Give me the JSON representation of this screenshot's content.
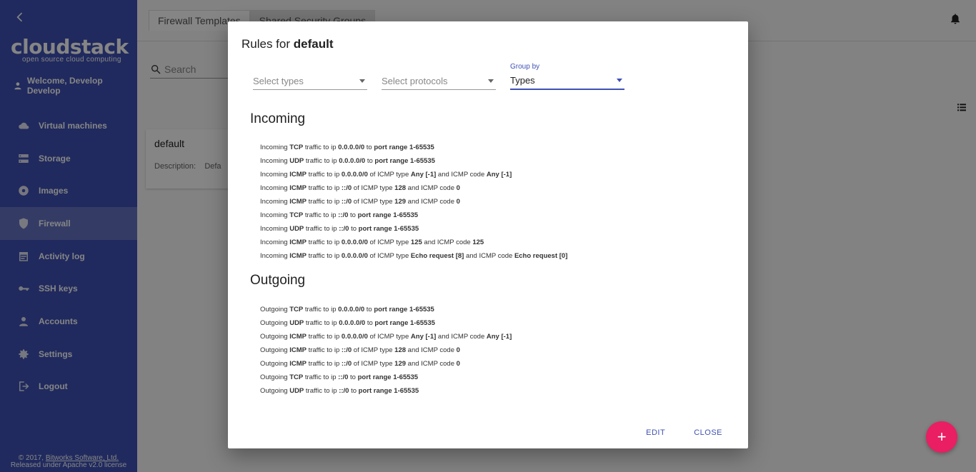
{
  "sidebar": {
    "logo_main": "cloudstack",
    "logo_sub": "open source cloud computing",
    "welcome": "Welcome, Develop Develop",
    "items": [
      {
        "label": "Virtual machines",
        "icon": "cloud-icon"
      },
      {
        "label": "Storage",
        "icon": "storage-icon"
      },
      {
        "label": "Images",
        "icon": "disc-icon"
      },
      {
        "label": "Firewall",
        "icon": "shield-icon",
        "active": true
      },
      {
        "label": "Activity log",
        "icon": "calendar-icon"
      },
      {
        "label": "SSH keys",
        "icon": "key-icon"
      },
      {
        "label": "Accounts",
        "icon": "person-icon"
      },
      {
        "label": "Settings",
        "icon": "gear-icon"
      },
      {
        "label": "Logout",
        "icon": "logout-icon"
      }
    ],
    "footer_line1_prefix": "© 2017,",
    "footer_link": "Bitworks Software, Ltd.",
    "footer_line2": "Released under Apache v2.0 license"
  },
  "topbar": {
    "tabs": [
      {
        "label": "Firewall Templates"
      },
      {
        "label": "Shared Security Groups",
        "active": true
      }
    ]
  },
  "search": {
    "placeholder": "Search"
  },
  "card": {
    "title": "default",
    "description_label": "Description:",
    "description_value": "Defa"
  },
  "fab_label": "+",
  "dialog": {
    "title_prefix": "Rules for",
    "title_name": "default",
    "filters": {
      "types_placeholder": "Select types",
      "protocols_placeholder": "Select protocols",
      "group_by_label": "Group by",
      "group_by_value": "Types"
    },
    "incoming_title": "Incoming",
    "outgoing_title": "Outgoing",
    "incoming": [
      [
        "Incoming",
        "TCP",
        "traffic to ip",
        "0.0.0.0/0",
        "to",
        "port range 1-65535"
      ],
      [
        "Incoming",
        "UDP",
        "traffic to ip",
        "0.0.0.0/0",
        "to",
        "port range 1-65535"
      ],
      [
        "Incoming",
        "ICMP",
        "traffic to ip",
        "0.0.0.0/0",
        "of ICMP type",
        "Any [-1]",
        "and ICMP code",
        "Any [-1]"
      ],
      [
        "Incoming",
        "ICMP",
        "traffic to ip",
        "::/0",
        "of ICMP type",
        "128",
        "and ICMP code",
        "0"
      ],
      [
        "Incoming",
        "ICMP",
        "traffic to ip",
        "::/0",
        "of ICMP type",
        "129",
        "and ICMP code",
        "0"
      ],
      [
        "Incoming",
        "TCP",
        "traffic to ip",
        "::/0",
        "to",
        "port range 1-65535"
      ],
      [
        "Incoming",
        "UDP",
        "traffic to ip",
        "::/0",
        "to",
        "port range 1-65535"
      ],
      [
        "Incoming",
        "ICMP",
        "traffic to ip",
        "0.0.0.0/0",
        "of ICMP type",
        "125",
        "and ICMP code",
        "125"
      ],
      [
        "Incoming",
        "ICMP",
        "traffic to ip",
        "0.0.0.0/0",
        "of ICMP type",
        "Echo request [8]",
        "and ICMP code",
        "Echo request [0]"
      ]
    ],
    "outgoing": [
      [
        "Outgoing",
        "TCP",
        "traffic to ip",
        "0.0.0.0/0",
        "to",
        "port range 1-65535"
      ],
      [
        "Outgoing",
        "UDP",
        "traffic to ip",
        "0.0.0.0/0",
        "to",
        "port range 1-65535"
      ],
      [
        "Outgoing",
        "ICMP",
        "traffic to ip",
        "0.0.0.0/0",
        "of ICMP type",
        "Any [-1]",
        "and ICMP code",
        "Any [-1]"
      ],
      [
        "Outgoing",
        "ICMP",
        "traffic to ip",
        "::/0",
        "of ICMP type",
        "128",
        "and ICMP code",
        "0"
      ],
      [
        "Outgoing",
        "ICMP",
        "traffic to ip",
        "::/0",
        "of ICMP type",
        "129",
        "and ICMP code",
        "0"
      ],
      [
        "Outgoing",
        "TCP",
        "traffic to ip",
        "::/0",
        "to",
        "port range 1-65535"
      ],
      [
        "Outgoing",
        "UDP",
        "traffic to ip",
        "::/0",
        "to",
        "port range 1-65535"
      ]
    ],
    "edit_label": "EDIT",
    "close_label": "CLOSE"
  },
  "colors": {
    "primary": "#3f51b5",
    "accent": "#e91e63"
  }
}
